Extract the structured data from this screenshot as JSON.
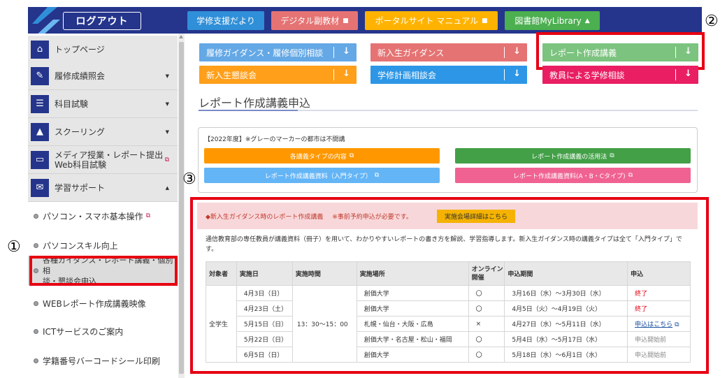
{
  "header": {
    "logout": "ログアウト",
    "buttons": [
      {
        "label": "学修支援だより",
        "color": "#2f8fd8"
      },
      {
        "label": "デジタル副教材",
        "color": "#e57373"
      },
      {
        "label": "ポータルサイト マニュアル",
        "color": "#ffb300"
      },
      {
        "label": "図書館MyLibrary",
        "color": "#4caf50"
      }
    ]
  },
  "sidebar": {
    "items": [
      {
        "label": "トップページ",
        "icon": "home-icon"
      },
      {
        "label": "履修成績照会",
        "icon": "pencil-icon"
      },
      {
        "label": "科目試験",
        "icon": "document-icon"
      },
      {
        "label": "スクーリング",
        "icon": "graduation-cap-icon"
      },
      {
        "label": "メディア授業・レポート提出",
        "label2": "Web科目試験",
        "icon": "monitor-icon"
      },
      {
        "label": "学習サポート",
        "icon": "chat-icon"
      }
    ],
    "subitems": [
      {
        "label": "パソコン・スマホ基本操作"
      },
      {
        "label": "パソコンスキル向上"
      },
      {
        "label": "各種ガイダンス・レポート講義・個別相",
        "label2": "談・懇談会申込"
      },
      {
        "label": "WEBレポート作成講義映像"
      },
      {
        "label": "ICTサービスのご案内"
      },
      {
        "label": "学籍番号バーコードシール印刷"
      }
    ]
  },
  "annotations": [
    "①",
    "②",
    "③"
  ],
  "tiles": [
    {
      "label": "履修ガイダンス・履修個別相談",
      "color": "#64a8e6"
    },
    {
      "label": "新入生ガイダンス",
      "color": "#e57373"
    },
    {
      "label": "レポート作成講義",
      "color": "#7cc37f"
    },
    {
      "label": "新入生懇談会",
      "color": "#ff9f1a"
    },
    {
      "label": "学修計画相談会",
      "color": "#2d96e6"
    },
    {
      "label": "教員による学修相談",
      "color": "#e91e63"
    }
  ],
  "page_title": "レポート作成講義申込",
  "info": {
    "note": "【2022年度】※グレーのマーカーの都市は不開講",
    "buttons": [
      {
        "label": "各講義タイプの内容",
        "color": "#ff9800"
      },
      {
        "label": "レポート作成講義の活用法",
        "color": "#43a047"
      },
      {
        "label": "レポート作成講義資料（入門タイプ）",
        "color": "#64b5f6"
      },
      {
        "label": "レポート作成講義資料(A・B・Cタイプ)",
        "color": "#f06292"
      }
    ]
  },
  "guidance": {
    "title": "◆新入生ガイダンス時のレポート作成講義",
    "note": "※事前予約申込が必要です。",
    "venue_button": "実施会場詳細はこちら",
    "description": "通信教育部の専任教員が講義資料（冊子）を用いて、わかりやすいレポートの書き方を解説、学習指導します。新入生ガイダンス時の講義タイプは全て「入門タイプ」です。"
  },
  "table": {
    "headers": [
      "対象者",
      "実施日",
      "実施時間",
      "実施場所",
      "オンライン開催",
      "申込期間",
      "申込"
    ],
    "target": "全学生",
    "time": "13：30～15：00",
    "rows": [
      {
        "date": "4月3日（日）",
        "place": "創価大学",
        "online": "〇",
        "period": "3月16日（水）～3月30日（水）",
        "apply": "終了"
      },
      {
        "date": "4月23日（土）",
        "place": "創価大学",
        "online": "〇",
        "period": "4月5日（火）～4月19日（火）",
        "apply": "終了"
      },
      {
        "date": "5月15日（日）",
        "place": "札幌・仙台・大阪・広島",
        "online": "×",
        "period": "4月27日（水）～5月11日（水）",
        "apply": "申込はこちら"
      },
      {
        "date": "5月22日（日）",
        "place": "創価大学・名古屋・松山・福岡",
        "online": "〇",
        "period": "5月4日（水）～5月17日（水）",
        "apply": "申込開始前"
      },
      {
        "date": "6月5日（日）",
        "place": "創価大学",
        "online": "〇",
        "period": "5月18日（水）～6月1日（水）",
        "apply": "申込開始前"
      }
    ]
  }
}
